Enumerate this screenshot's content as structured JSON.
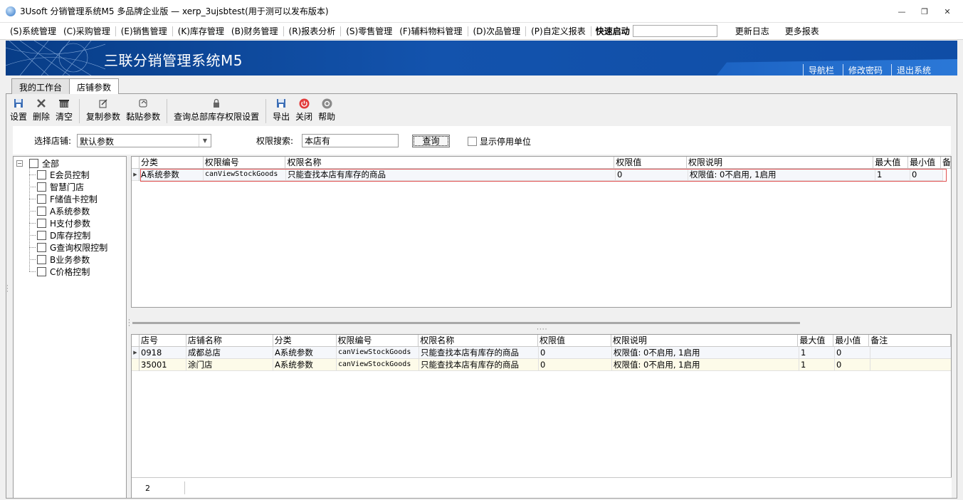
{
  "window": {
    "title": "3Usoft 分销管理系统M5 多品牌企业版 — xerp_3ujsbtest(用于测可以发布版本)",
    "controls": [
      "—",
      "❐",
      "✕"
    ]
  },
  "menu": {
    "items": [
      "(S)系统管理",
      "(C)采购管理",
      "(E)销售管理",
      "(K)库存管理",
      "(B)财务管理",
      "(R)报表分析",
      "(S)零售管理",
      "(F)辅料物料管理",
      "(D)次品管理",
      "(P)自定义报表"
    ],
    "quick_label": "快速启动",
    "quick_value": "",
    "right_items": [
      "更新日志",
      "更多报表"
    ]
  },
  "banner": {
    "title": "三联分销管理系统M5",
    "links": [
      "导航栏",
      "修改密码",
      "退出系统"
    ]
  },
  "tabs": [
    "我的工作台",
    "店铺参数"
  ],
  "active_tab": "店铺参数",
  "toolbar": [
    {
      "label": "设置",
      "icon": "save-icon"
    },
    {
      "label": "删除",
      "icon": "delete-icon"
    },
    {
      "label": "清空",
      "icon": "clear-icon"
    },
    {
      "label": "复制参数",
      "icon": "copy-icon"
    },
    {
      "label": "黏贴参数",
      "icon": "paste-icon"
    },
    {
      "label": "查询总部库存权限设置",
      "icon": "lock-icon"
    },
    {
      "label": "导出",
      "icon": "export-icon"
    },
    {
      "label": "关闭",
      "icon": "close-icon"
    },
    {
      "label": "帮助",
      "icon": "help-icon"
    }
  ],
  "filter": {
    "store_label": "选择店铺:",
    "store_value": "默认参数",
    "search_label": "权限搜索:",
    "search_value": "本店有",
    "query_button": "查询",
    "show_disabled_label": "显示停用单位"
  },
  "tree": {
    "root": "全部",
    "children": [
      "E会员控制",
      "智慧门店",
      "F储值卡控制",
      "A系统参数",
      "H支付参数",
      "D库存控制",
      "G查询权限控制",
      "B业务参数",
      "C价格控制"
    ]
  },
  "top_grid": {
    "columns": [
      "分类",
      "权限编号",
      "权限名称",
      "权限值",
      "权限说明",
      "最大值",
      "最小值",
      "备"
    ],
    "rows": [
      [
        "A系统参数",
        "canViewStockGoods",
        "只能查找本店有库存的商品",
        "0",
        "权限值: 0不启用, 1启用",
        "1",
        "0",
        ""
      ]
    ]
  },
  "bottom_grid": {
    "columns": [
      "店号",
      "店铺名称",
      "分类",
      "权限编号",
      "权限名称",
      "权限值",
      "权限说明",
      "最大值",
      "最小值",
      "备注"
    ],
    "rows": [
      [
        "0918",
        "成都总店",
        "A系统参数",
        "canViewStockGoods",
        "只能查找本店有库存的商品",
        "0",
        "权限值: 0不启用, 1启用",
        "1",
        "0",
        ""
      ],
      [
        "35001",
        "涂门店",
        "A系统参数",
        "canViewStockGoods",
        "只能查找本店有库存的商品",
        "0",
        "权限值: 0不启用, 1启用",
        "1",
        "0",
        ""
      ]
    ],
    "footer_count": "2"
  },
  "colors": {
    "banner": "#0f4da6",
    "highlight_border": "#e05050",
    "row_alt": "#fdfbe9"
  }
}
